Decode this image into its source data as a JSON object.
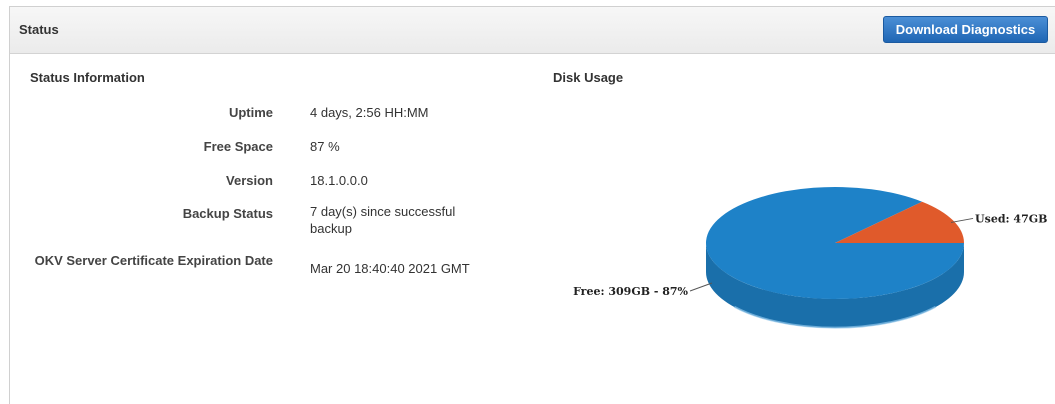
{
  "header": {
    "title": "Status",
    "download_button": "Download Diagnostics"
  },
  "status_info": {
    "title": "Status Information",
    "rows": [
      {
        "label": "Uptime",
        "value": "4 days, 2:56 HH:MM"
      },
      {
        "label": "Free Space",
        "value": "87 %"
      },
      {
        "label": "Version",
        "value": "18.1.0.0.0"
      },
      {
        "label": "Backup Status",
        "value": "7 day(s) since successful backup"
      },
      {
        "label": "OKV Server Certificate Expiration Date",
        "value": "Mar 20 18:40:40 2021 GMT"
      }
    ]
  },
  "disk_usage": {
    "title": "Disk Usage"
  },
  "chart_data": {
    "type": "pie",
    "title": "Disk Usage",
    "slices": [
      {
        "name": "Free",
        "value": 309,
        "unit": "GB",
        "percent": 87,
        "color": "#1e82c8",
        "label": "Free: 309GB - 87%"
      },
      {
        "name": "Used",
        "value": 47,
        "unit": "GB",
        "color": "#e05a2b",
        "label": "Used: 47GB"
      }
    ],
    "style": "3d"
  }
}
